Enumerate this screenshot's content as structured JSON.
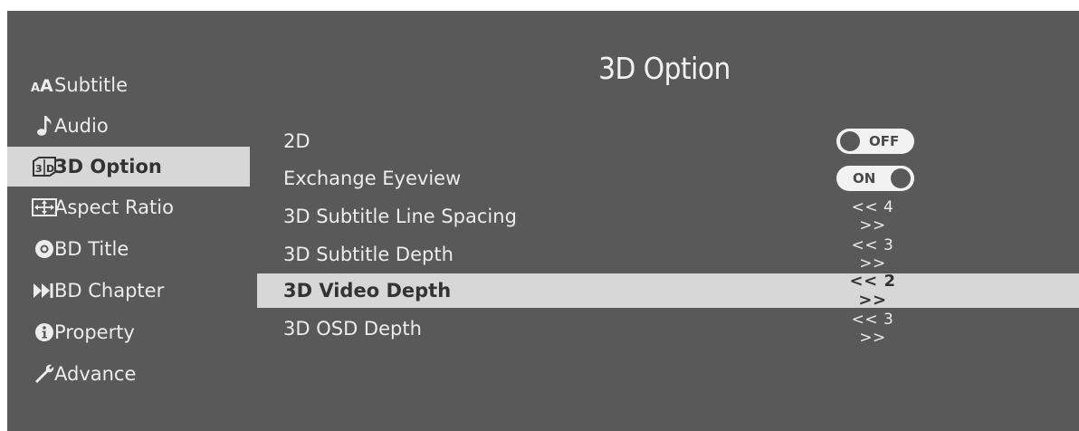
{
  "title": "3D Option",
  "sidebar": {
    "items": [
      {
        "label": "Subtitle",
        "icon": "subtitle-aa-icon",
        "active": false
      },
      {
        "label": "Audio",
        "icon": "music-note-icon",
        "active": false
      },
      {
        "label": "3D Option",
        "icon": "3d-icon",
        "active": true
      },
      {
        "label": "Aspect Ratio",
        "icon": "aspect-ratio-icon",
        "active": false
      },
      {
        "label": "BD Title",
        "icon": "disc-icon",
        "active": false
      },
      {
        "label": "BD Chapter",
        "icon": "skip-forward-icon",
        "active": false
      },
      {
        "label": "Property",
        "icon": "info-icon",
        "active": false
      },
      {
        "label": "Advance",
        "icon": "wrench-icon",
        "active": false
      }
    ]
  },
  "options": [
    {
      "label": "2D",
      "type": "toggle",
      "value": "OFF"
    },
    {
      "label": "Exchange Eyeview",
      "type": "toggle",
      "value": "ON"
    },
    {
      "label": "3D Subtitle Line Spacing",
      "type": "stepper",
      "value": "<< 4 >>"
    },
    {
      "label": "3D Subtitle Depth",
      "type": "stepper",
      "value": "<< 3 >>"
    },
    {
      "label": "3D Video Depth",
      "type": "stepper",
      "value": "<< 2 >>",
      "active": true
    },
    {
      "label": "3D OSD Depth",
      "type": "stepper",
      "value": "<< 3 >>"
    }
  ],
  "colors": {
    "panel": "#595959",
    "highlight": "#d7d7d7",
    "text": "#ececec",
    "highlight_text": "#333333"
  }
}
